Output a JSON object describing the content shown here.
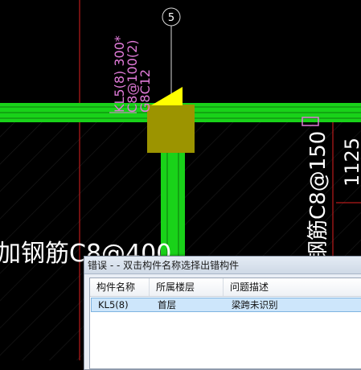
{
  "cad": {
    "axis_number": "5",
    "beam_annotation": [
      "KL5(8) 300*",
      "C8@100(2)",
      "G8C12"
    ],
    "left_text": "加钢筋C8@400",
    "right_rebar_text": "钢筋C8@150",
    "dimension_text": "1125",
    "colors": {
      "beam": "#19d219",
      "column": "#9c9400",
      "marker": "#ffff00",
      "grid_line": "#e02020",
      "axis_line": "#d8d8d8",
      "annotation_pink": "#e07ad8"
    }
  },
  "dialog": {
    "title": "错误 -  - 双击构件名称选择出错构件",
    "columns": [
      "构件名称",
      "所属楼层",
      "问题描述"
    ],
    "rows": [
      {
        "name": "KL5(8)",
        "floor": "首层",
        "issue": "梁跨未识别"
      }
    ]
  }
}
